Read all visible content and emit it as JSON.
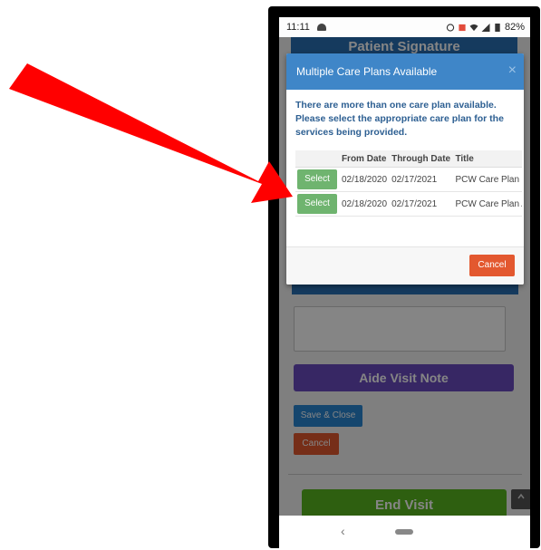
{
  "status_bar": {
    "time": "11:11",
    "battery": "82%"
  },
  "background": {
    "patient_signature": "Patient Signature",
    "aide_visit_note": "Aide Visit Note",
    "save_close": "Save & Close",
    "cancel": "Cancel",
    "end_visit": "End Visit"
  },
  "modal": {
    "title": "Multiple Care Plans Available",
    "close_glyph": "×",
    "message": "There are more than one care plan available. Please select the appropriate care plan for the services being provided.",
    "columns": [
      "",
      "From Date",
      "Through Date",
      "Title"
    ],
    "rows": [
      {
        "action": "Select",
        "from": "02/18/2020",
        "through": "02/17/2021",
        "title": "PCW Care Plan F"
      },
      {
        "action": "Select",
        "from": "02/18/2020",
        "through": "02/17/2021",
        "title": "PCW Care Plan A"
      }
    ],
    "cancel": "Cancel"
  },
  "nav": {
    "back_glyph": "‹"
  },
  "colors": {
    "modal_header": "#3f86c8",
    "select_button": "#6fb46f",
    "cancel_button": "#e3582f",
    "arrow": "#ff0000"
  }
}
